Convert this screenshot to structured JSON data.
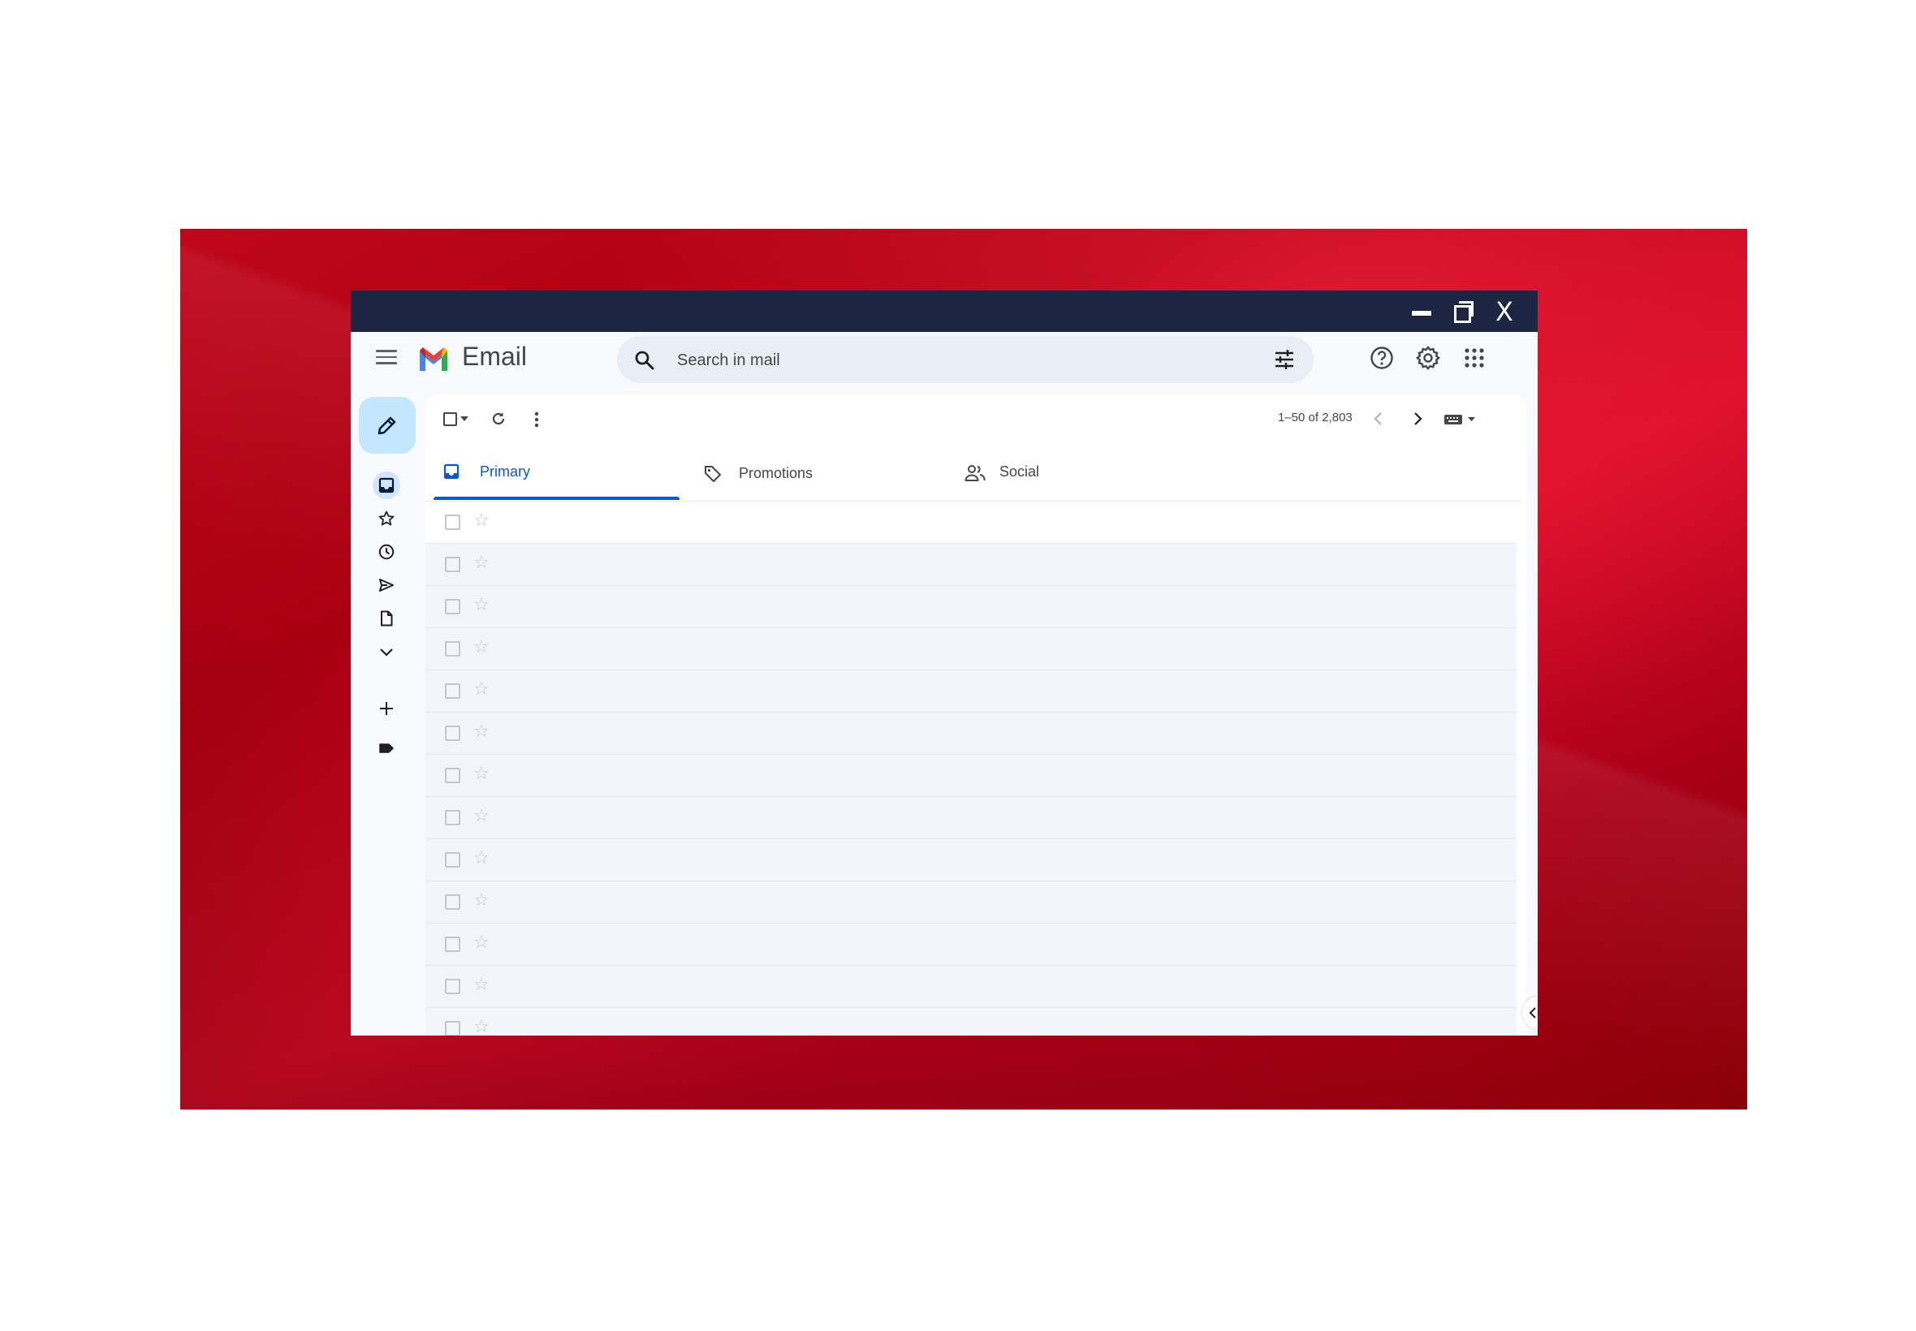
{
  "window": {
    "controls": {
      "minimize_icon": "minimize-icon",
      "restore_icon": "restore-icon",
      "close_label": "X"
    }
  },
  "header": {
    "app_title": "Email",
    "search": {
      "placeholder": "Search in mail"
    },
    "icons": [
      "menu-icon",
      "search-icon",
      "filter-icon",
      "help-icon",
      "settings-icon",
      "apps-icon"
    ]
  },
  "toolbar": {
    "pagination": "1–50 of 2,803"
  },
  "tabs": [
    {
      "label": "Primary",
      "active": true
    },
    {
      "label": "Promotions",
      "active": false
    },
    {
      "label": "Social",
      "active": false
    }
  ],
  "rail": {
    "items": [
      "compose",
      "inbox",
      "starred",
      "snoozed",
      "sent",
      "drafts",
      "more",
      "new-label",
      "label"
    ]
  },
  "rows": {
    "count": 13
  },
  "colors": {
    "accent": "#0b57d0",
    "titlebar": "#1c2541",
    "compose_bg": "#c2e7ff",
    "desktop": "#c0061a"
  }
}
